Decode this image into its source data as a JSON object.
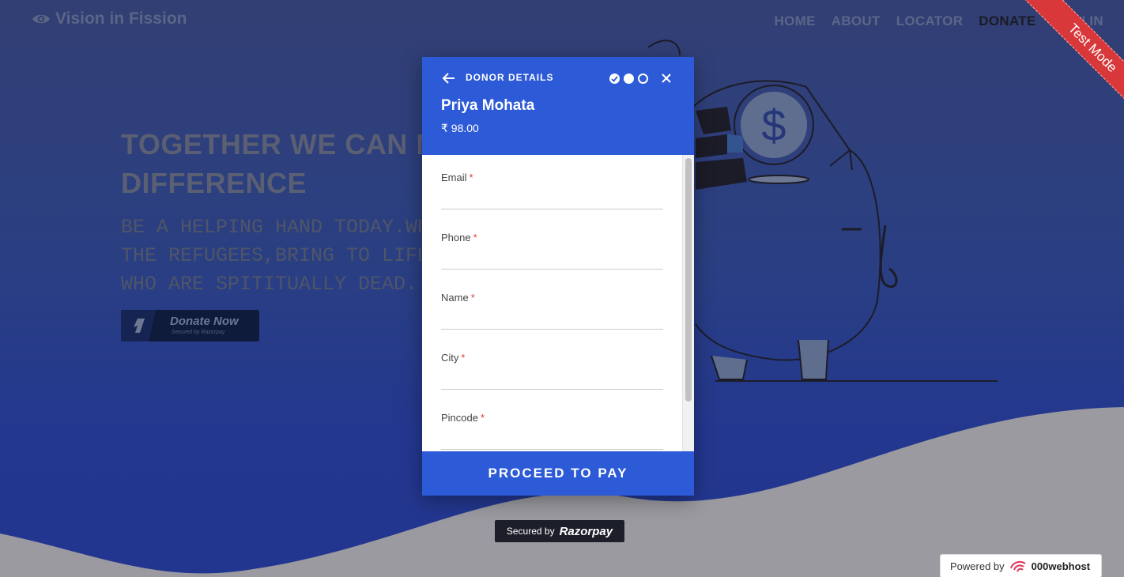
{
  "site": {
    "brand": "Vision in Fission",
    "nav": [
      "HOME",
      "ABOUT",
      "LOCATOR",
      "DONATE",
      "SIGN IN"
    ],
    "active_nav": "DONATE",
    "hero_title_lines": [
      "TOGETHER WE CAN MAKE A",
      "DIFFERENCE"
    ],
    "hero_text_lines": [
      "BE A HELPING HAND TODAY.WE HELP",
      "THE REFUGEES,BRING TO LIFE THOSE",
      "WHO ARE SPITITUALLY DEAD."
    ],
    "donate_button": {
      "label": "Donate Now",
      "sub": "Secured by Razorpay"
    },
    "ribbon": "Test Mode",
    "powered_by": {
      "prefix": "Powered by",
      "host": "000webhost"
    }
  },
  "modal": {
    "step_title": "DONOR DETAILS",
    "steps": [
      "done",
      "current",
      "pending"
    ],
    "payee": "Priya Mohata",
    "amount": "₹ 98.00",
    "fields": [
      {
        "label": "Email",
        "required": "*",
        "value": ""
      },
      {
        "label": "Phone",
        "required": "*",
        "value": ""
      },
      {
        "label": "Name",
        "required": "*",
        "value": ""
      },
      {
        "label": "City",
        "required": "*",
        "value": ""
      },
      {
        "label": "Pincode",
        "required": "*",
        "value": ""
      }
    ],
    "proceed_label": "PROCEED TO PAY",
    "secured_prefix": "Secured by",
    "secured_brand": "Razorpay"
  },
  "colors": {
    "modal_accent": "#2d5ad6",
    "ribbon": "#d8383a",
    "page_bg": "#2b3e78",
    "required": "#e23b3b"
  },
  "icons": [
    "eye-icon",
    "back-arrow-icon",
    "check-icon",
    "close-icon",
    "razorpay-logo-icon",
    "piggy-bank-illustration",
    "000webhost-logo-icon"
  ]
}
